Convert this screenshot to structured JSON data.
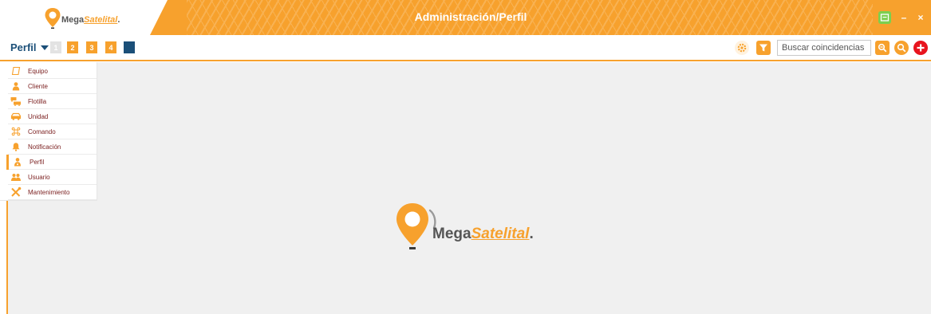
{
  "window": {
    "title": "Administración/Perfil",
    "brand_main": "Mega",
    "brand_accent": "Satelital",
    "brand_dot": ".",
    "minimize_label": "–",
    "close_label": "×"
  },
  "toolbar": {
    "view_label": "Perfil",
    "pages": [
      "1",
      "2",
      "3",
      "4",
      ""
    ],
    "search": {
      "placeholder": "Buscar coincidencias",
      "value": ""
    },
    "icons": [
      "gear-icon",
      "filter-icon",
      "zoom-icon",
      "search-icon",
      "add-icon"
    ]
  },
  "menu": {
    "items": [
      {
        "label": "Equipo",
        "icon": "device-icon"
      },
      {
        "label": "Cliente",
        "icon": "client-icon"
      },
      {
        "label": "Flotilla",
        "icon": "fleet-icon"
      },
      {
        "label": "Unidad",
        "icon": "vehicle-icon"
      },
      {
        "label": "Comando",
        "icon": "command-icon"
      },
      {
        "label": "Notificación",
        "icon": "bell-icon"
      },
      {
        "label": "Perfil",
        "icon": "profile-icon"
      },
      {
        "label": "Usuario",
        "icon": "users-icon"
      },
      {
        "label": "Mantenimiento",
        "icon": "tools-icon"
      }
    ],
    "active": "Perfil"
  },
  "content": {
    "logo_main": "Mega",
    "logo_accent": "Satelital",
    "logo_dot": "."
  },
  "colors": {
    "accent": "#f7a12d",
    "navy": "#1b4f78",
    "menu_text": "#7a1e1e",
    "add_red": "#e8141e",
    "app_green": "#7ccf4f",
    "content_bg": "#f0f0f0"
  }
}
